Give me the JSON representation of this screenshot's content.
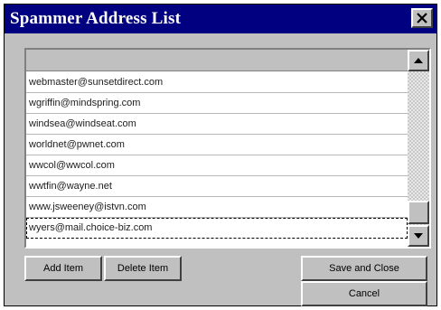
{
  "window": {
    "title": "Spammer Address List",
    "close_icon": "close-icon"
  },
  "list": {
    "rows": [
      "webmaster@sunsetdirect.com",
      "wgriffin@mindspring.com",
      "windsea@windseat.com",
      "worldnet@pwnet.com",
      "wwcol@wwcol.com",
      "wwtfin@wayne.net",
      "www.jsweeney@istvn.com",
      "wyers@mail.choice-biz.com"
    ],
    "selected_index": 7
  },
  "buttons": {
    "add_item": "Add Item",
    "delete_item": "Delete Item",
    "save_and_close": "Save and Close",
    "cancel": "Cancel"
  },
  "icons": {
    "scroll_up": "triangle-up-icon",
    "scroll_down": "triangle-down-icon"
  }
}
